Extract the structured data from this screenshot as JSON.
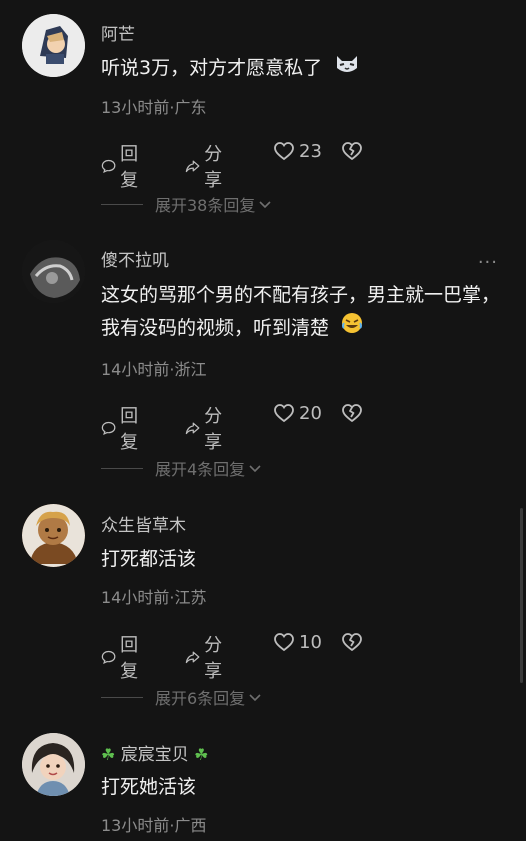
{
  "comments": [
    {
      "username": "阿芒",
      "text": "听说3万，对方才愿意私了",
      "meta": "13小时前·广东",
      "reply_label": "回复",
      "share_label": "分享",
      "likes": "23",
      "replies_label": "展开38条回复"
    },
    {
      "username": "傻不拉叽",
      "text": "这女的骂那个男的不配有孩子，男主就一巴掌，我有没码的视频，听到清楚",
      "meta": "14小时前·浙江",
      "reply_label": "回复",
      "share_label": "分享",
      "likes": "20",
      "replies_label": "展开4条回复",
      "more": "···"
    },
    {
      "username": "众生皆草木",
      "text": "打死都活该",
      "meta": "14小时前·江苏",
      "reply_label": "回复",
      "share_label": "分享",
      "likes": "10",
      "replies_label": "展开6条回复"
    },
    {
      "username": "宸宸宝贝",
      "username_decor": "☘",
      "text": "打死她活该",
      "meta": "13小时前·广西"
    }
  ]
}
